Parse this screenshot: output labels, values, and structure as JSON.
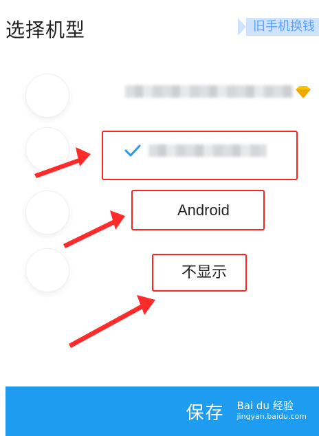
{
  "header": {
    "title": "选择机型",
    "promo_label": "旧手机换钱"
  },
  "options": [
    {
      "label": "",
      "selected": false,
      "has_badge": true
    },
    {
      "label": "",
      "selected": true
    },
    {
      "label": "Android",
      "selected": false
    },
    {
      "label": "不显示",
      "selected": false
    }
  ],
  "footer": {
    "save_label": "保存",
    "watermark_brand": "Bai du 经验",
    "watermark_url": "jingyan.baidu.com"
  },
  "colors": {
    "accent": "#1e9cf0",
    "promo_bg": "#cfe3ff",
    "promo_text": "#5aa2ff",
    "annotation": "#ff2020",
    "check": "#2a9ae8",
    "badge": "#f5c400"
  },
  "icons": {
    "check": "checkmark-icon",
    "badge": "diamond-icon"
  }
}
